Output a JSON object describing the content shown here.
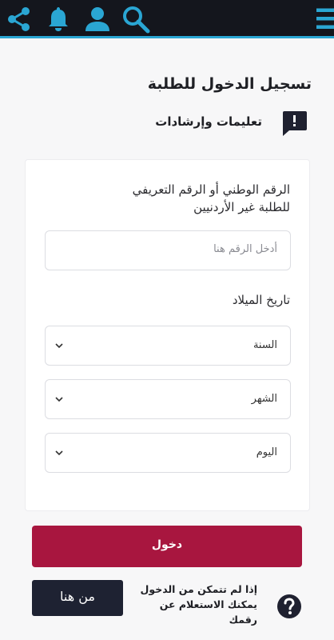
{
  "header": {
    "icons": [
      "share-icon",
      "bell-icon",
      "user-icon",
      "search-icon",
      "menu-icon"
    ],
    "icon_color": "#2aa6d3",
    "background": "#14161d"
  },
  "page": {
    "title": "تسجيل الدخول للطلبة",
    "instructions_label": "تعليمات وإرشادات"
  },
  "form": {
    "national_id_label": "الرقم الوطني أو الرقم التعريفي للطلبة غير الأردنيين",
    "national_id_placeholder": "أدخل الرقم هنا",
    "dob_label": "تاريخ الميلاد",
    "year_select": "السنة",
    "month_select": "الشهر",
    "day_select": "اليوم",
    "login_button": "دخول"
  },
  "help": {
    "text": "إذا لم تتمكن من الدخول يمكنك الاستعلام عن رقمك",
    "button": "من هنا"
  },
  "colors": {
    "accent": "#a8163f",
    "dark_button": "#1e2232"
  }
}
